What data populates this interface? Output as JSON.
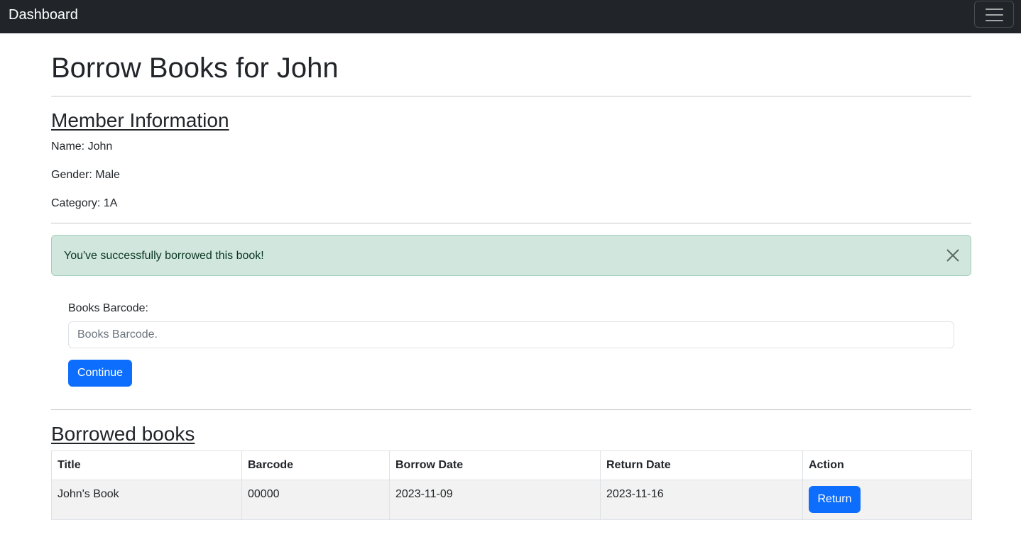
{
  "navbar": {
    "brand": "Dashboard",
    "toggler_icon": "hamburger-menu-icon"
  },
  "page": {
    "title": "Borrow Books for John"
  },
  "member_info": {
    "heading": "Member Information",
    "name_line": "Name: John",
    "gender_line": "Gender: Male",
    "category_line": "Category: 1A"
  },
  "alert": {
    "message": "You've successfully borrowed this book!",
    "close_icon": "close-icon",
    "background_color": "#d1e7dd"
  },
  "borrow_form": {
    "label": "Books Barcode:",
    "input_value": "",
    "input_placeholder": "Books Barcode.",
    "submit_label": "Continue"
  },
  "borrowed_books": {
    "heading": "Borrowed books",
    "columns": [
      "Title",
      "Barcode",
      "Borrow Date",
      "Return Date",
      "Action"
    ],
    "rows": [
      {
        "title": "John's Book",
        "barcode": "00000",
        "borrow_date": "2023-11-09",
        "return_date": "2023-11-16",
        "action_label": "Return"
      }
    ]
  },
  "colors": {
    "navbar": "#212529",
    "primary": "#0d6efd",
    "alert_success": "#d1e7dd"
  }
}
